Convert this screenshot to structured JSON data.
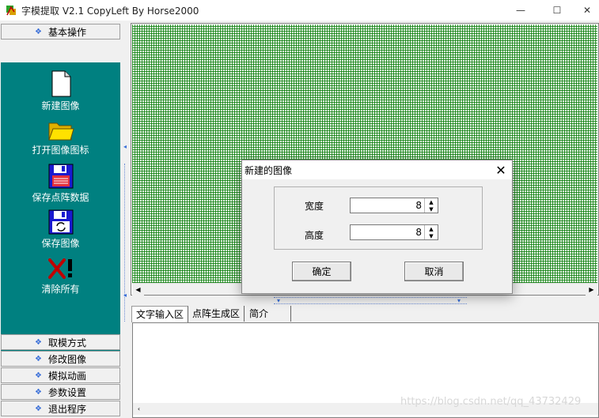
{
  "window": {
    "title": "字模提取 V2.1  CopyLeft By Horse2000",
    "minimize": "—",
    "maximize": "☐",
    "close": "✕"
  },
  "left_panel": {
    "top_section": "基本操作",
    "tools": [
      {
        "label": "新建图像",
        "icon": "new-file-icon"
      },
      {
        "label": "打开图像图标",
        "icon": "open-folder-icon"
      },
      {
        "label": "保存点阵数据",
        "icon": "save-matrix-icon"
      },
      {
        "label": "保存图像",
        "icon": "save-image-icon"
      },
      {
        "label": "清除所有",
        "icon": "clear-all-icon"
      }
    ],
    "bottom_sections": [
      "取模方式",
      "修改图像",
      "模拟动画",
      "参数设置",
      "退出程序"
    ]
  },
  "tabs": [
    "文字输入区",
    "点阵生成区",
    "简介"
  ],
  "dialog": {
    "title": "新建的图像",
    "width_label": "宽度",
    "width_value": "8",
    "height_label": "高度",
    "height_value": "8",
    "ok_label": "确定",
    "cancel_label": "取消"
  },
  "watermark": "https://blog.csdn.net/qq_43732429",
  "colors": {
    "accent": "#008080",
    "grid": "#008000",
    "diamond": "#3a6fd8"
  }
}
